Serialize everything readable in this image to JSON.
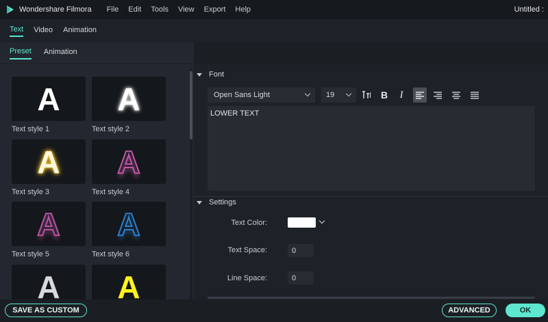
{
  "titlebar": {
    "app_name": "Wondershare Filmora",
    "menu": [
      "File",
      "Edit",
      "Tools",
      "View",
      "Export",
      "Help"
    ],
    "doc_title": "Untitled :"
  },
  "top_tabs": [
    "Text",
    "Video",
    "Animation"
  ],
  "left_panel": {
    "sub_tabs": [
      "Preset",
      "Animation"
    ],
    "tiles": [
      {
        "label": "Text style 1",
        "glyph": "A"
      },
      {
        "label": "Text style 2",
        "glyph": "A"
      },
      {
        "label": "Text style 3",
        "glyph": "A"
      },
      {
        "label": "Text style 4",
        "glyph": "A"
      },
      {
        "label": "Text style 5",
        "glyph": "A"
      },
      {
        "label": "Text style 6",
        "glyph": "A"
      },
      {
        "label": "",
        "glyph": "A"
      },
      {
        "label": "",
        "glyph": "A"
      }
    ]
  },
  "font_section": {
    "title": "Font",
    "font_family": "Open Sans Light",
    "font_size": "19",
    "text": "LOWER TEXT"
  },
  "settings_section": {
    "title": "Settings",
    "text_color_label": "Text Color:",
    "text_color": "#ffffff",
    "text_space_label": "Text Space:",
    "text_space": "0",
    "line_space_label": "Line Space:",
    "line_space": "0"
  },
  "footer": {
    "save_custom": "SAVE AS CUSTOM",
    "advanced": "ADVANCED",
    "ok": "OK"
  },
  "colors": {
    "accent": "#5ee6cf",
    "background": "#1d2128"
  }
}
